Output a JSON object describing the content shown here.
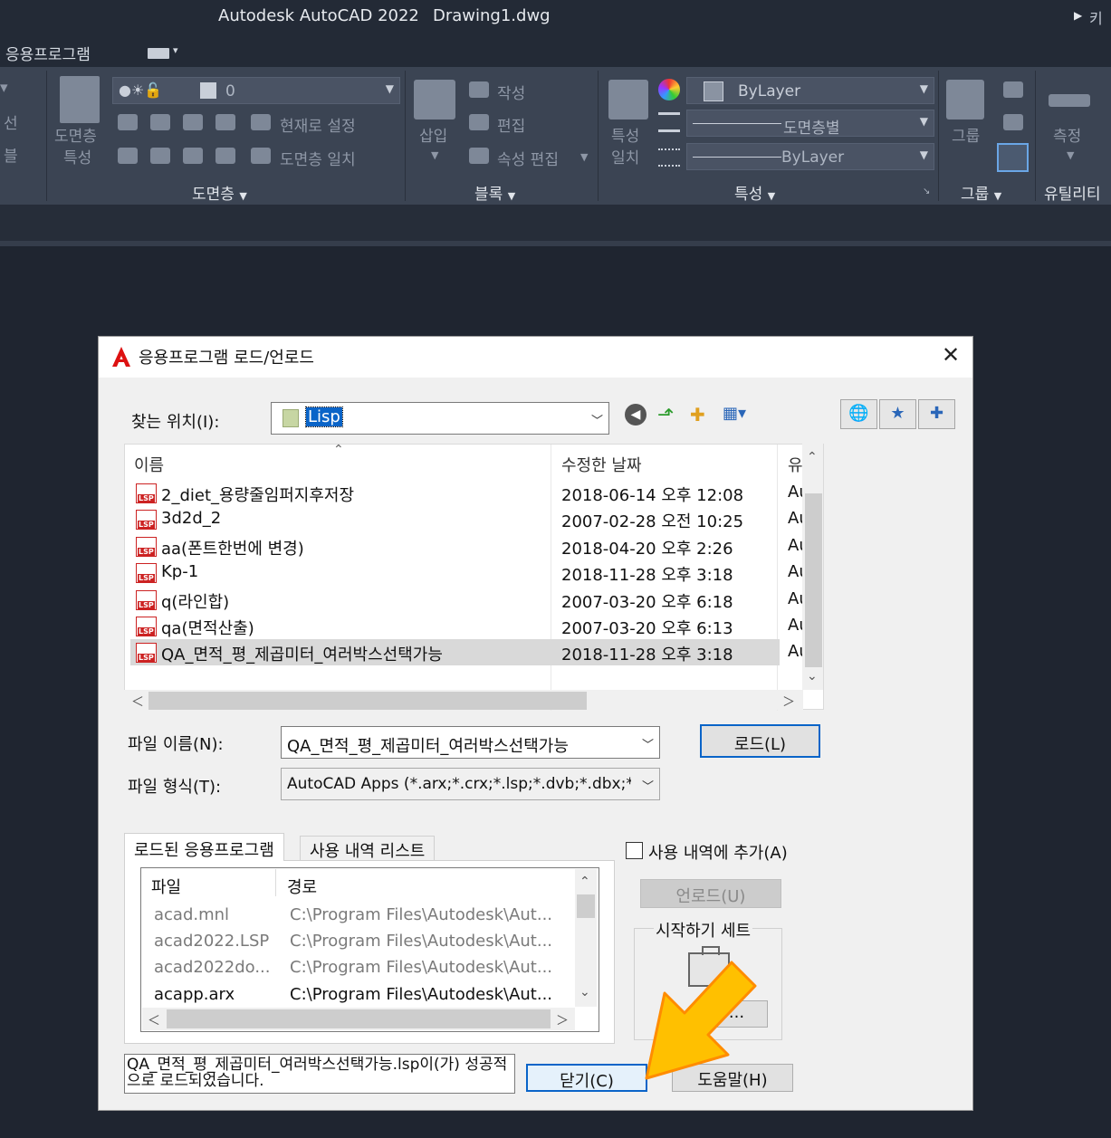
{
  "window": {
    "app_title": "Autodesk AutoCAD 2022",
    "doc_title": "Drawing1.dwg",
    "right_text": "키"
  },
  "tabs": {
    "apps": "응용프로그램"
  },
  "ribbon": {
    "left_fragments": [
      "선",
      "블"
    ],
    "layer_props": [
      "도면층",
      "특성"
    ],
    "layer_combo": "0",
    "set_current": "현재로 설정",
    "match_layer": "도면층 일치",
    "layer_panel": "도면층",
    "insert": "삽입",
    "block_create": "작성",
    "block_edit": "편집",
    "attr_edit": "속성 편집",
    "block_panel": "블록",
    "match_props": [
      "특성",
      "일치"
    ],
    "color_combo": "ByLayer",
    "linetype_combo": "도면층별",
    "lineweight_combo": "ByLayer",
    "props_panel": "특성",
    "group": "그룹",
    "group_panel": "그룹",
    "measure": "측정",
    "utility_panel": "유틸리티"
  },
  "dialog": {
    "title": "응용프로그램 로드/언로드",
    "look_in_label": "찾는 위치(I):",
    "look_in_value": "Lisp",
    "columns": {
      "name": "이름",
      "modified": "수정한 날짜",
      "type": "유"
    },
    "files": [
      {
        "name": "2_diet_용량줄임퍼지후저장",
        "date": "2018-06-14 오후 12:08",
        "type": "Au"
      },
      {
        "name": "3d2d_2",
        "date": "2007-02-28 오전 10:25",
        "type": "Au"
      },
      {
        "name": "aa(폰트한번에 변경)",
        "date": "2018-04-20 오후 2:26",
        "type": "Au"
      },
      {
        "name": "Kp-1",
        "date": "2018-11-28 오후 3:18",
        "type": "Au"
      },
      {
        "name": "q(라인합)",
        "date": "2007-03-20 오후 6:18",
        "type": "Au"
      },
      {
        "name": "qa(면적산출)",
        "date": "2007-03-20 오후 6:13",
        "type": "Au"
      },
      {
        "name": "QA_면적_평_제곱미터_여러박스선택가능",
        "date": "2018-11-28 오후 3:18",
        "type": "Au"
      }
    ],
    "selected_file_index": 6,
    "file_name_label": "파일 이름(N):",
    "file_name_value": "QA_면적_평_제곱미터_여러박스선택가능",
    "file_type_label": "파일 형식(T):",
    "file_type_value": "AutoCAD Apps (*.arx;*.crx;*.lsp;*.dvb;*.dbx;*.v",
    "load_button": "로드(L)",
    "tab_loaded": "로드된 응용프로그램",
    "tab_history": "사용 내역 리스트",
    "history_checkbox": "사용 내역에 추가(A)",
    "unload_button": "언로드(U)",
    "startup_suite": "시작하기 세트",
    "contents_button": "...",
    "loaded_columns": {
      "file": "파일",
      "path": "경로"
    },
    "loaded": [
      {
        "file": "acad.mnl",
        "path": "C:\\Program Files\\Autodesk\\Aut..."
      },
      {
        "file": "acad2022.LSP",
        "path": "C:\\Program Files\\Autodesk\\Aut..."
      },
      {
        "file": "acad2022do...",
        "path": "C:\\Program Files\\Autodesk\\Aut..."
      },
      {
        "file": "acapp.arx",
        "path": "C:\\Program Files\\Autodesk\\Aut..."
      }
    ],
    "status": "QA_면적_평_제곱미터_여러박스선택가능.lsp이(가) 성공적으로 로드되었습니다.",
    "close_button": "닫기(C)",
    "help_button": "도움말(H)"
  },
  "colors": {
    "accent": "#0a64c8",
    "arrow": "#ffc000",
    "lsp_red": "#cc2222"
  }
}
